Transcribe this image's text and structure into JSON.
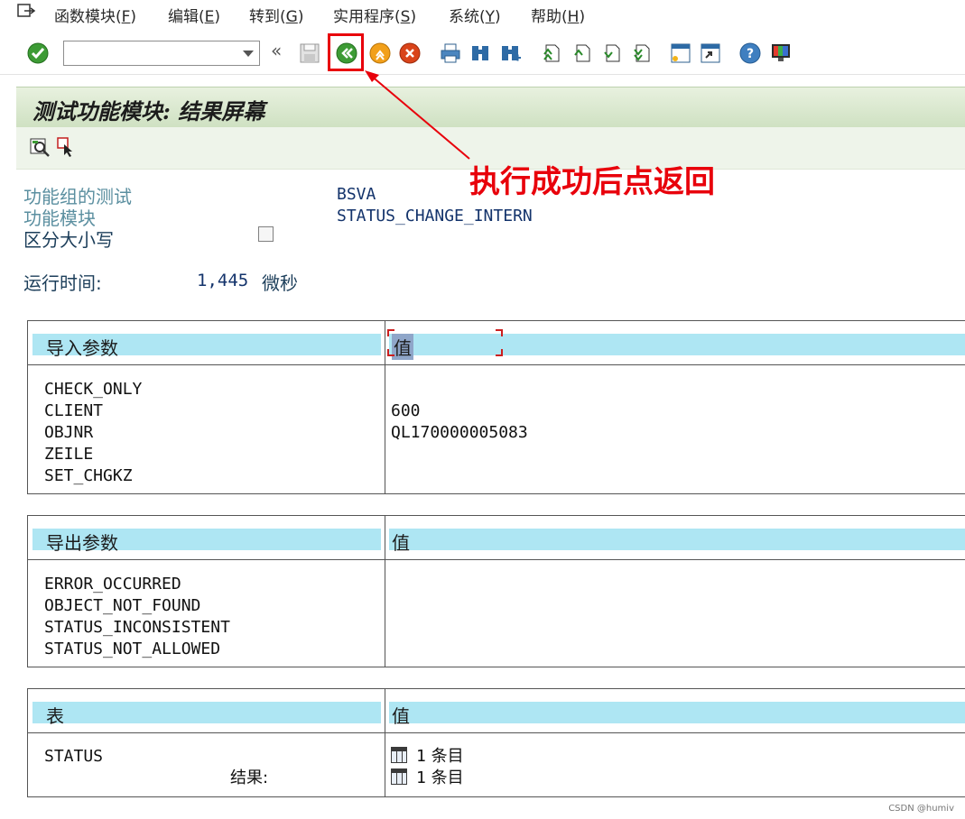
{
  "menu": {
    "items": [
      {
        "text": "函数模块(",
        "key": "F",
        "close": ")"
      },
      {
        "text": "编辑(",
        "key": "E",
        "close": ")"
      },
      {
        "text": "转到(",
        "key": "G",
        "close": ")"
      },
      {
        "text": "实用程序(",
        "key": "S",
        "close": ")"
      },
      {
        "text": "系统(",
        "key": "Y",
        "close": ")"
      },
      {
        "text": "帮助(",
        "key": "H",
        "close": ")"
      }
    ]
  },
  "toolbar": {
    "command_value": "",
    "chevrons": "«"
  },
  "title": "测试功能模块: 结果屏幕",
  "annotation": "执行成功后点返回",
  "info": {
    "group_label": "功能组的测试",
    "group_value": "BSVA",
    "module_label": "功能模块",
    "module_value": "STATUS_CHANGE_INTERN",
    "case_label": "区分大小写",
    "case_checked": false,
    "runtime_label": "运行时间:",
    "runtime_value": "1,445",
    "runtime_unit": "微秒"
  },
  "import_table": {
    "header_left": "导入参数",
    "header_right": "值",
    "params": [
      "CHECK_ONLY",
      "CLIENT",
      "OBJNR",
      "ZEILE",
      "SET_CHGKZ"
    ],
    "values": [
      "",
      "600",
      "QL170000005083",
      "",
      ""
    ]
  },
  "export_table": {
    "header_left": "导出参数",
    "header_right": "值",
    "params": [
      "ERROR_OCCURRED",
      "OBJECT_NOT_FOUND",
      "STATUS_INCONSISTENT",
      "STATUS_NOT_ALLOWED"
    ]
  },
  "tables_table": {
    "header_left": "表",
    "header_right": "值",
    "row_name": "STATUS",
    "row_result_label": "结果:",
    "entry_count_1": "1",
    "entry_unit_1": "条目",
    "entry_count_2": "1",
    "entry_unit_2": "条目"
  },
  "watermark": "CSDN @humiv",
  "colors": {
    "header_band": "#aee6f3",
    "title_bar": "#cfe1c2",
    "annotation": "#e8000b"
  }
}
